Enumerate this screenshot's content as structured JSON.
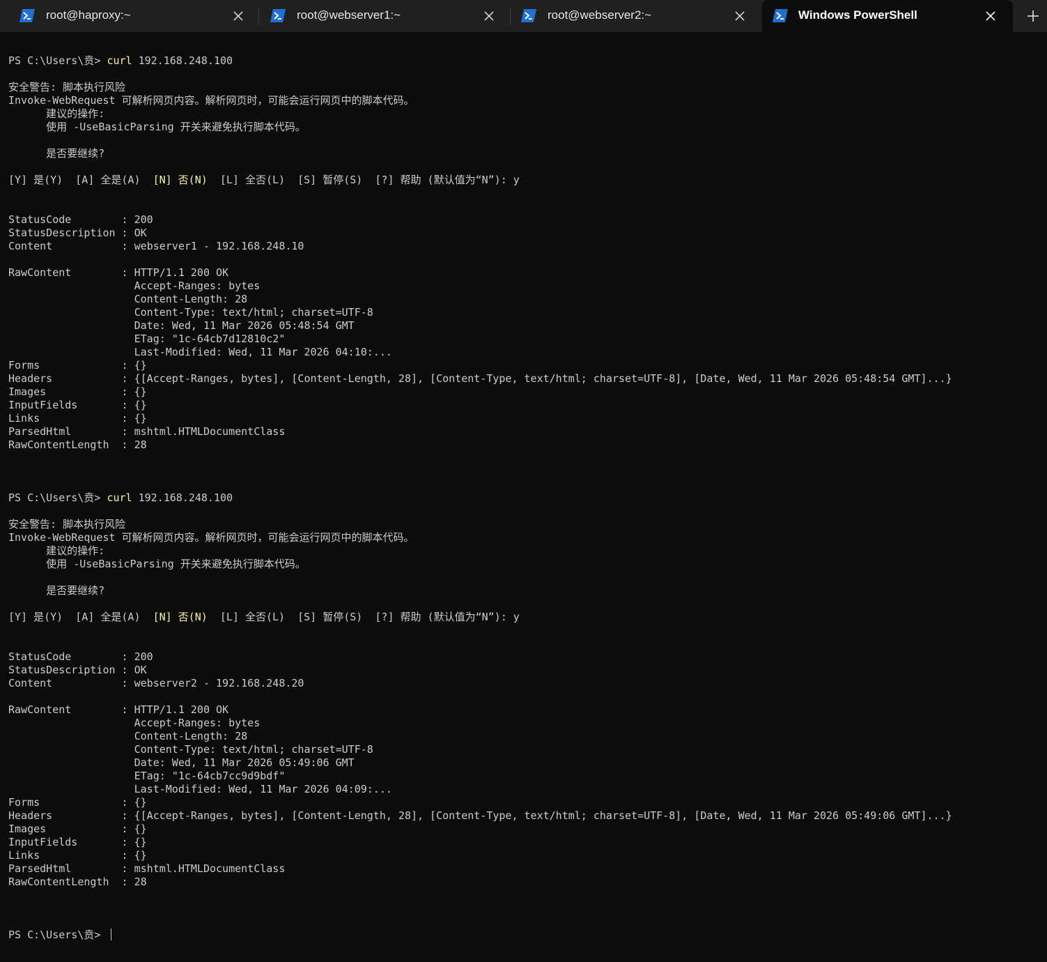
{
  "colors": {
    "tabbar_bg": "#202020",
    "terminal_bg": "#0c0c0c",
    "text": "#cccccc",
    "highlight": "#f9f1a5",
    "powershell_icon": "#1f6fd4"
  },
  "tabs": [
    {
      "title": "root@haproxy:~",
      "icon": "powershell-icon",
      "active": false
    },
    {
      "title": "root@webserver1:~",
      "icon": "powershell-icon",
      "active": false
    },
    {
      "title": "root@webserver2:~",
      "icon": "powershell-icon",
      "active": false
    },
    {
      "title": "Windows PowerShell",
      "icon": "powershell-icon",
      "active": true
    }
  ],
  "new_tab_icon": "plus-icon",
  "terminal": {
    "lines": [
      {
        "segments": [
          {
            "text": "PS C:\\Users\\贲> "
          },
          {
            "text": "curl",
            "style": "cmd"
          },
          {
            "text": " 192.168.248.100"
          }
        ]
      },
      {
        "segments": []
      },
      {
        "segments": [
          {
            "text": "安全警告: 脚本执行风险"
          }
        ]
      },
      {
        "segments": [
          {
            "text": "Invoke-WebRequest 可解析网页内容。解析网页时，可能会运行网页中的脚本代码。"
          }
        ]
      },
      {
        "segments": [
          {
            "text": "      建议的操作:"
          }
        ]
      },
      {
        "segments": [
          {
            "text": "      使用 -UseBasicParsing 开关来避免执行脚本代码。"
          }
        ]
      },
      {
        "segments": []
      },
      {
        "segments": [
          {
            "text": "      是否要继续?"
          }
        ]
      },
      {
        "segments": []
      },
      {
        "segments": [
          {
            "text": "[Y] 是(Y)  [A] 全是(A)  "
          },
          {
            "text": "[N] 否(N)",
            "style": "hl"
          },
          {
            "text": "  [L] 全否(L)  [S] 暂停(S)  [?] 帮助 (默认值为“N”): y"
          }
        ]
      },
      {
        "segments": []
      },
      {
        "segments": []
      },
      {
        "segments": [
          {
            "text": "StatusCode        : 200"
          }
        ]
      },
      {
        "segments": [
          {
            "text": "StatusDescription : OK"
          }
        ]
      },
      {
        "segments": [
          {
            "text": "Content           : webserver1 - 192.168.248.10"
          }
        ]
      },
      {
        "segments": []
      },
      {
        "segments": [
          {
            "text": "RawContent        : HTTP/1.1 200 OK"
          }
        ]
      },
      {
        "segments": [
          {
            "text": "                    Accept-Ranges: bytes"
          }
        ]
      },
      {
        "segments": [
          {
            "text": "                    Content-Length: 28"
          }
        ]
      },
      {
        "segments": [
          {
            "text": "                    Content-Type: text/html; charset=UTF-8"
          }
        ]
      },
      {
        "segments": [
          {
            "text": "                    Date: Wed, 11 Mar 2026 05:48:54 GMT"
          }
        ]
      },
      {
        "segments": [
          {
            "text": "                    ETag: \"1c-64cb7d12810c2\""
          }
        ]
      },
      {
        "segments": [
          {
            "text": "                    Last-Modified: Wed, 11 Mar 2026 04:10:..."
          }
        ]
      },
      {
        "segments": [
          {
            "text": "Forms             : {}"
          }
        ]
      },
      {
        "segments": [
          {
            "text": "Headers           : {[Accept-Ranges, bytes], [Content-Length, 28], [Content-Type, text/html; charset=UTF-8], [Date, Wed, 11 Mar 2026 05:48:54 GMT]...}"
          }
        ]
      },
      {
        "segments": [
          {
            "text": "Images            : {}"
          }
        ]
      },
      {
        "segments": [
          {
            "text": "InputFields       : {}"
          }
        ]
      },
      {
        "segments": [
          {
            "text": "Links             : {}"
          }
        ]
      },
      {
        "segments": [
          {
            "text": "ParsedHtml        : mshtml.HTMLDocumentClass"
          }
        ]
      },
      {
        "segments": [
          {
            "text": "RawContentLength  : 28"
          }
        ]
      },
      {
        "segments": []
      },
      {
        "segments": []
      },
      {
        "segments": []
      },
      {
        "segments": [
          {
            "text": "PS C:\\Users\\贲> "
          },
          {
            "text": "curl",
            "style": "cmd"
          },
          {
            "text": " 192.168.248.100"
          }
        ]
      },
      {
        "segments": []
      },
      {
        "segments": [
          {
            "text": "安全警告: 脚本执行风险"
          }
        ]
      },
      {
        "segments": [
          {
            "text": "Invoke-WebRequest 可解析网页内容。解析网页时，可能会运行网页中的脚本代码。"
          }
        ]
      },
      {
        "segments": [
          {
            "text": "      建议的操作:"
          }
        ]
      },
      {
        "segments": [
          {
            "text": "      使用 -UseBasicParsing 开关来避免执行脚本代码。"
          }
        ]
      },
      {
        "segments": []
      },
      {
        "segments": [
          {
            "text": "      是否要继续?"
          }
        ]
      },
      {
        "segments": []
      },
      {
        "segments": [
          {
            "text": "[Y] 是(Y)  [A] 全是(A)  "
          },
          {
            "text": "[N] 否(N)",
            "style": "hl"
          },
          {
            "text": "  [L] 全否(L)  [S] 暂停(S)  [?] 帮助 (默认值为“N”): y"
          }
        ]
      },
      {
        "segments": []
      },
      {
        "segments": []
      },
      {
        "segments": [
          {
            "text": "StatusCode        : 200"
          }
        ]
      },
      {
        "segments": [
          {
            "text": "StatusDescription : OK"
          }
        ]
      },
      {
        "segments": [
          {
            "text": "Content           : webserver2 - 192.168.248.20"
          }
        ]
      },
      {
        "segments": []
      },
      {
        "segments": [
          {
            "text": "RawContent        : HTTP/1.1 200 OK"
          }
        ]
      },
      {
        "segments": [
          {
            "text": "                    Accept-Ranges: bytes"
          }
        ]
      },
      {
        "segments": [
          {
            "text": "                    Content-Length: 28"
          }
        ]
      },
      {
        "segments": [
          {
            "text": "                    Content-Type: text/html; charset=UTF-8"
          }
        ]
      },
      {
        "segments": [
          {
            "text": "                    Date: Wed, 11 Mar 2026 05:49:06 GMT"
          }
        ]
      },
      {
        "segments": [
          {
            "text": "                    ETag: \"1c-64cb7cc9d9bdf\""
          }
        ]
      },
      {
        "segments": [
          {
            "text": "                    Last-Modified: Wed, 11 Mar 2026 04:09:..."
          }
        ]
      },
      {
        "segments": [
          {
            "text": "Forms             : {}"
          }
        ]
      },
      {
        "segments": [
          {
            "text": "Headers           : {[Accept-Ranges, bytes], [Content-Length, 28], [Content-Type, text/html; charset=UTF-8], [Date, Wed, 11 Mar 2026 05:49:06 GMT]...}"
          }
        ]
      },
      {
        "segments": [
          {
            "text": "Images            : {}"
          }
        ]
      },
      {
        "segments": [
          {
            "text": "InputFields       : {}"
          }
        ]
      },
      {
        "segments": [
          {
            "text": "Links             : {}"
          }
        ]
      },
      {
        "segments": [
          {
            "text": "ParsedHtml        : mshtml.HTMLDocumentClass"
          }
        ]
      },
      {
        "segments": [
          {
            "text": "RawContentLength  : 28"
          }
        ]
      },
      {
        "segments": []
      },
      {
        "segments": []
      },
      {
        "segments": []
      },
      {
        "segments": [
          {
            "text": "PS C:\\Users\\贲> "
          }
        ],
        "cursor": true
      }
    ]
  }
}
